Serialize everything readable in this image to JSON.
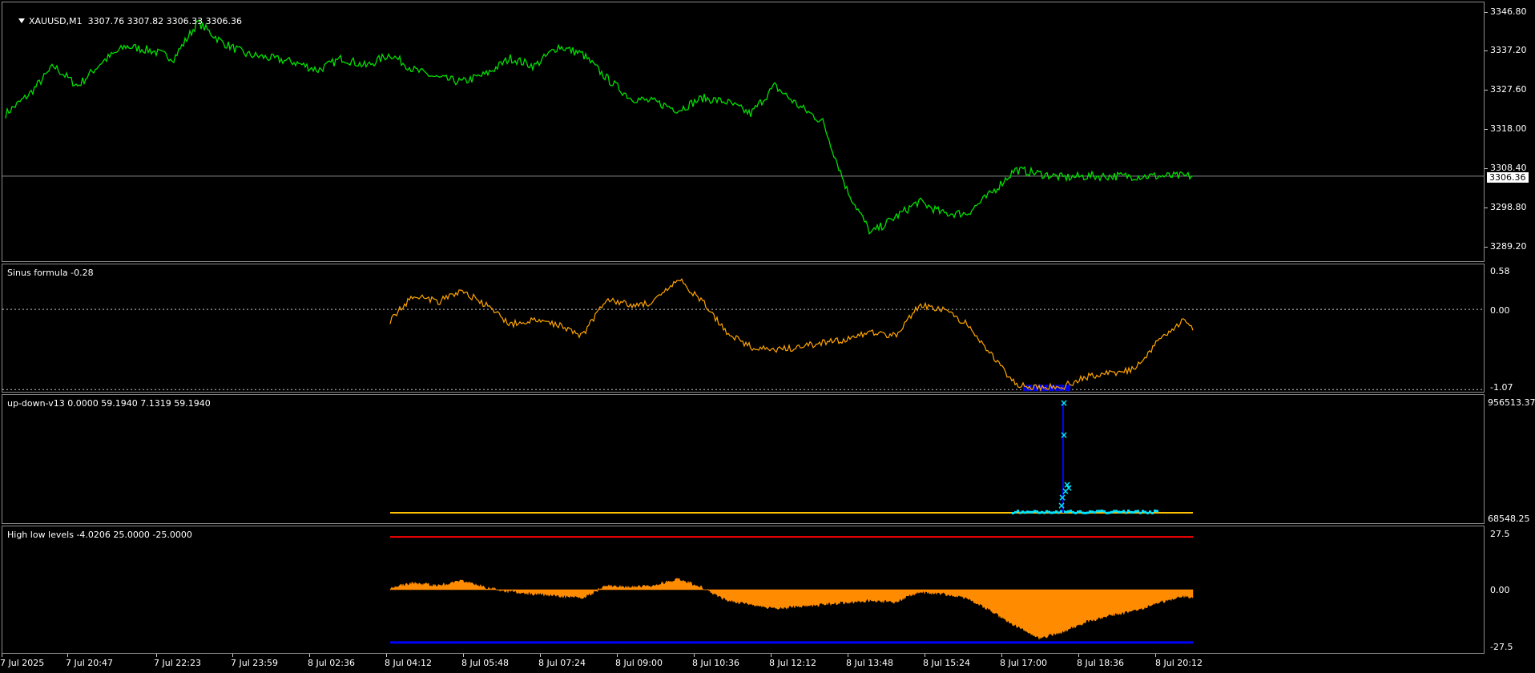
{
  "main": {
    "title": "XAUUSD,M1",
    "ohlc": "3307.76 3307.82 3306.33 3306.36",
    "current_price": "3306.36",
    "scale": [
      "3346.80",
      "3337.20",
      "3327.60",
      "3318.00",
      "3308.40",
      "3298.80",
      "3289.20"
    ]
  },
  "sinus": {
    "label": "Sinus formula -0.28",
    "scale": [
      "0.58",
      "0.00",
      "-1.07"
    ]
  },
  "updown": {
    "label": "up-down-v13 0.0000 59.1940 7.1319 59.1940",
    "scale": [
      "956513.37",
      "68548.25"
    ]
  },
  "hilo": {
    "label": "High low levels -4.0206 25.0000 -25.0000",
    "scale": [
      "27.5",
      "0.00",
      "-27.5"
    ]
  },
  "time_axis": [
    "7 Jul 2025",
    "7 Jul 20:47",
    "7 Jul 22:23",
    "7 Jul 23:59",
    "8 Jul 02:36",
    "8 Jul 04:12",
    "8 Jul 05:48",
    "8 Jul 07:24",
    "8 Jul 09:00",
    "8 Jul 10:36",
    "8 Jul 12:12",
    "8 Jul 13:48",
    "8 Jul 15:24",
    "8 Jul 17:00",
    "8 Jul 18:36",
    "8 Jul 20:12"
  ],
  "colors": {
    "price": "#00e000",
    "sinus": "#ffa500",
    "updown_x": "#00e5ff",
    "updown_bars": "#0000ff",
    "histogram": "#ff8c00",
    "upper_level": "#ff0000",
    "lower_level": "#0000ff",
    "updown_base": "#ffc000"
  },
  "chart_data": [
    {
      "type": "line",
      "name": "price",
      "ylim": [
        3285.0,
        3350.0
      ],
      "x": [
        0,
        30,
        60,
        90,
        120,
        150,
        180,
        210,
        240,
        270,
        300,
        330,
        360,
        390,
        420,
        450,
        480,
        510,
        540,
        570,
        600,
        630,
        660,
        690,
        720,
        750,
        780,
        810,
        840,
        870,
        900,
        930,
        960,
        990,
        1020,
        1050,
        1080,
        1110,
        1140,
        1170,
        1200,
        1230,
        1260,
        1290,
        1320,
        1350,
        1380,
        1410,
        1440,
        1470,
        1482
      ],
      "y": [
        3322,
        3327,
        3334,
        3329,
        3335,
        3339,
        3338,
        3336,
        3345,
        3340,
        3337,
        3336,
        3335,
        3333,
        3336,
        3334,
        3337,
        3333,
        3331,
        3330,
        3332,
        3336,
        3334,
        3339,
        3337,
        3331,
        3326,
        3325,
        3323,
        3326,
        3325,
        3322,
        3329,
        3324,
        3320,
        3303,
        3292,
        3296,
        3300,
        3297,
        3297,
        3302,
        3308,
        3307,
        3306,
        3306.36,
        3306.36,
        3306.36,
        3306.36,
        3306.36,
        3306.36
      ]
    },
    {
      "type": "line",
      "name": "sinus",
      "ylim": [
        -1.1,
        0.6
      ],
      "x": [
        480,
        510,
        540,
        570,
        600,
        630,
        660,
        690,
        720,
        750,
        780,
        810,
        840,
        870,
        900,
        930,
        960,
        990,
        1020,
        1050,
        1080,
        1110,
        1140,
        1170,
        1200,
        1230,
        1260,
        1290,
        1320,
        1350,
        1380,
        1410,
        1440,
        1470,
        1482
      ],
      "y": [
        -0.15,
        0.2,
        0.1,
        0.25,
        0.05,
        -0.2,
        -0.15,
        -0.2,
        -0.35,
        0.15,
        0.05,
        0.1,
        0.4,
        0.1,
        -0.3,
        -0.5,
        -0.55,
        -0.5,
        -0.45,
        -0.4,
        -0.3,
        -0.35,
        0.05,
        0.0,
        -0.2,
        -0.6,
        -1.0,
        -1.05,
        -1.02,
        -0.9,
        -0.85,
        -0.8,
        -0.4,
        -0.15,
        -0.28
      ]
    },
    {
      "type": "bar",
      "name": "histogram",
      "ylim": [
        -27.5,
        27.5
      ],
      "x": [
        480,
        510,
        540,
        570,
        600,
        630,
        660,
        690,
        720,
        750,
        780,
        810,
        840,
        870,
        900,
        930,
        960,
        990,
        1020,
        1050,
        1080,
        1110,
        1140,
        1170,
        1200,
        1230,
        1260,
        1290,
        1320,
        1350,
        1380,
        1410,
        1440,
        1470,
        1482
      ],
      "values": [
        1,
        3,
        2,
        4,
        1,
        -1,
        -2,
        -3,
        -4,
        2,
        1,
        2,
        5,
        1,
        -5,
        -7,
        -9,
        -8,
        -7,
        -6,
        -5,
        -6,
        -1,
        -2,
        -4,
        -10,
        -17,
        -23,
        -20,
        -15,
        -12,
        -10,
        -6,
        -3,
        -4.02
      ]
    }
  ]
}
